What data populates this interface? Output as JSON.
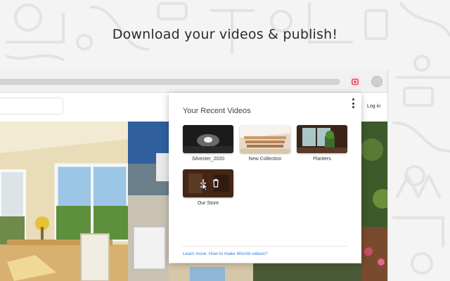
{
  "headline": "Download your videos & publish!",
  "colors": {
    "accent": "#e8334a",
    "link": "#3a7bd5",
    "background": "#f4f4f4"
  },
  "browser": {
    "login_label": "Log in",
    "extension_icon": "wochit-video-icon",
    "profile_icon": "avatar-icon"
  },
  "popup": {
    "title": "Your Recent Videos",
    "menu_icon": "more-vertical-icon",
    "videos": [
      {
        "label": "Silvester_2020"
      },
      {
        "label": "New Collection"
      },
      {
        "label": "Planters"
      },
      {
        "label": "Our Store",
        "hover_icons": [
          "download-icon",
          "trash-icon"
        ]
      }
    ],
    "learn_more": "Learn more: How to make Wochit videos?"
  }
}
